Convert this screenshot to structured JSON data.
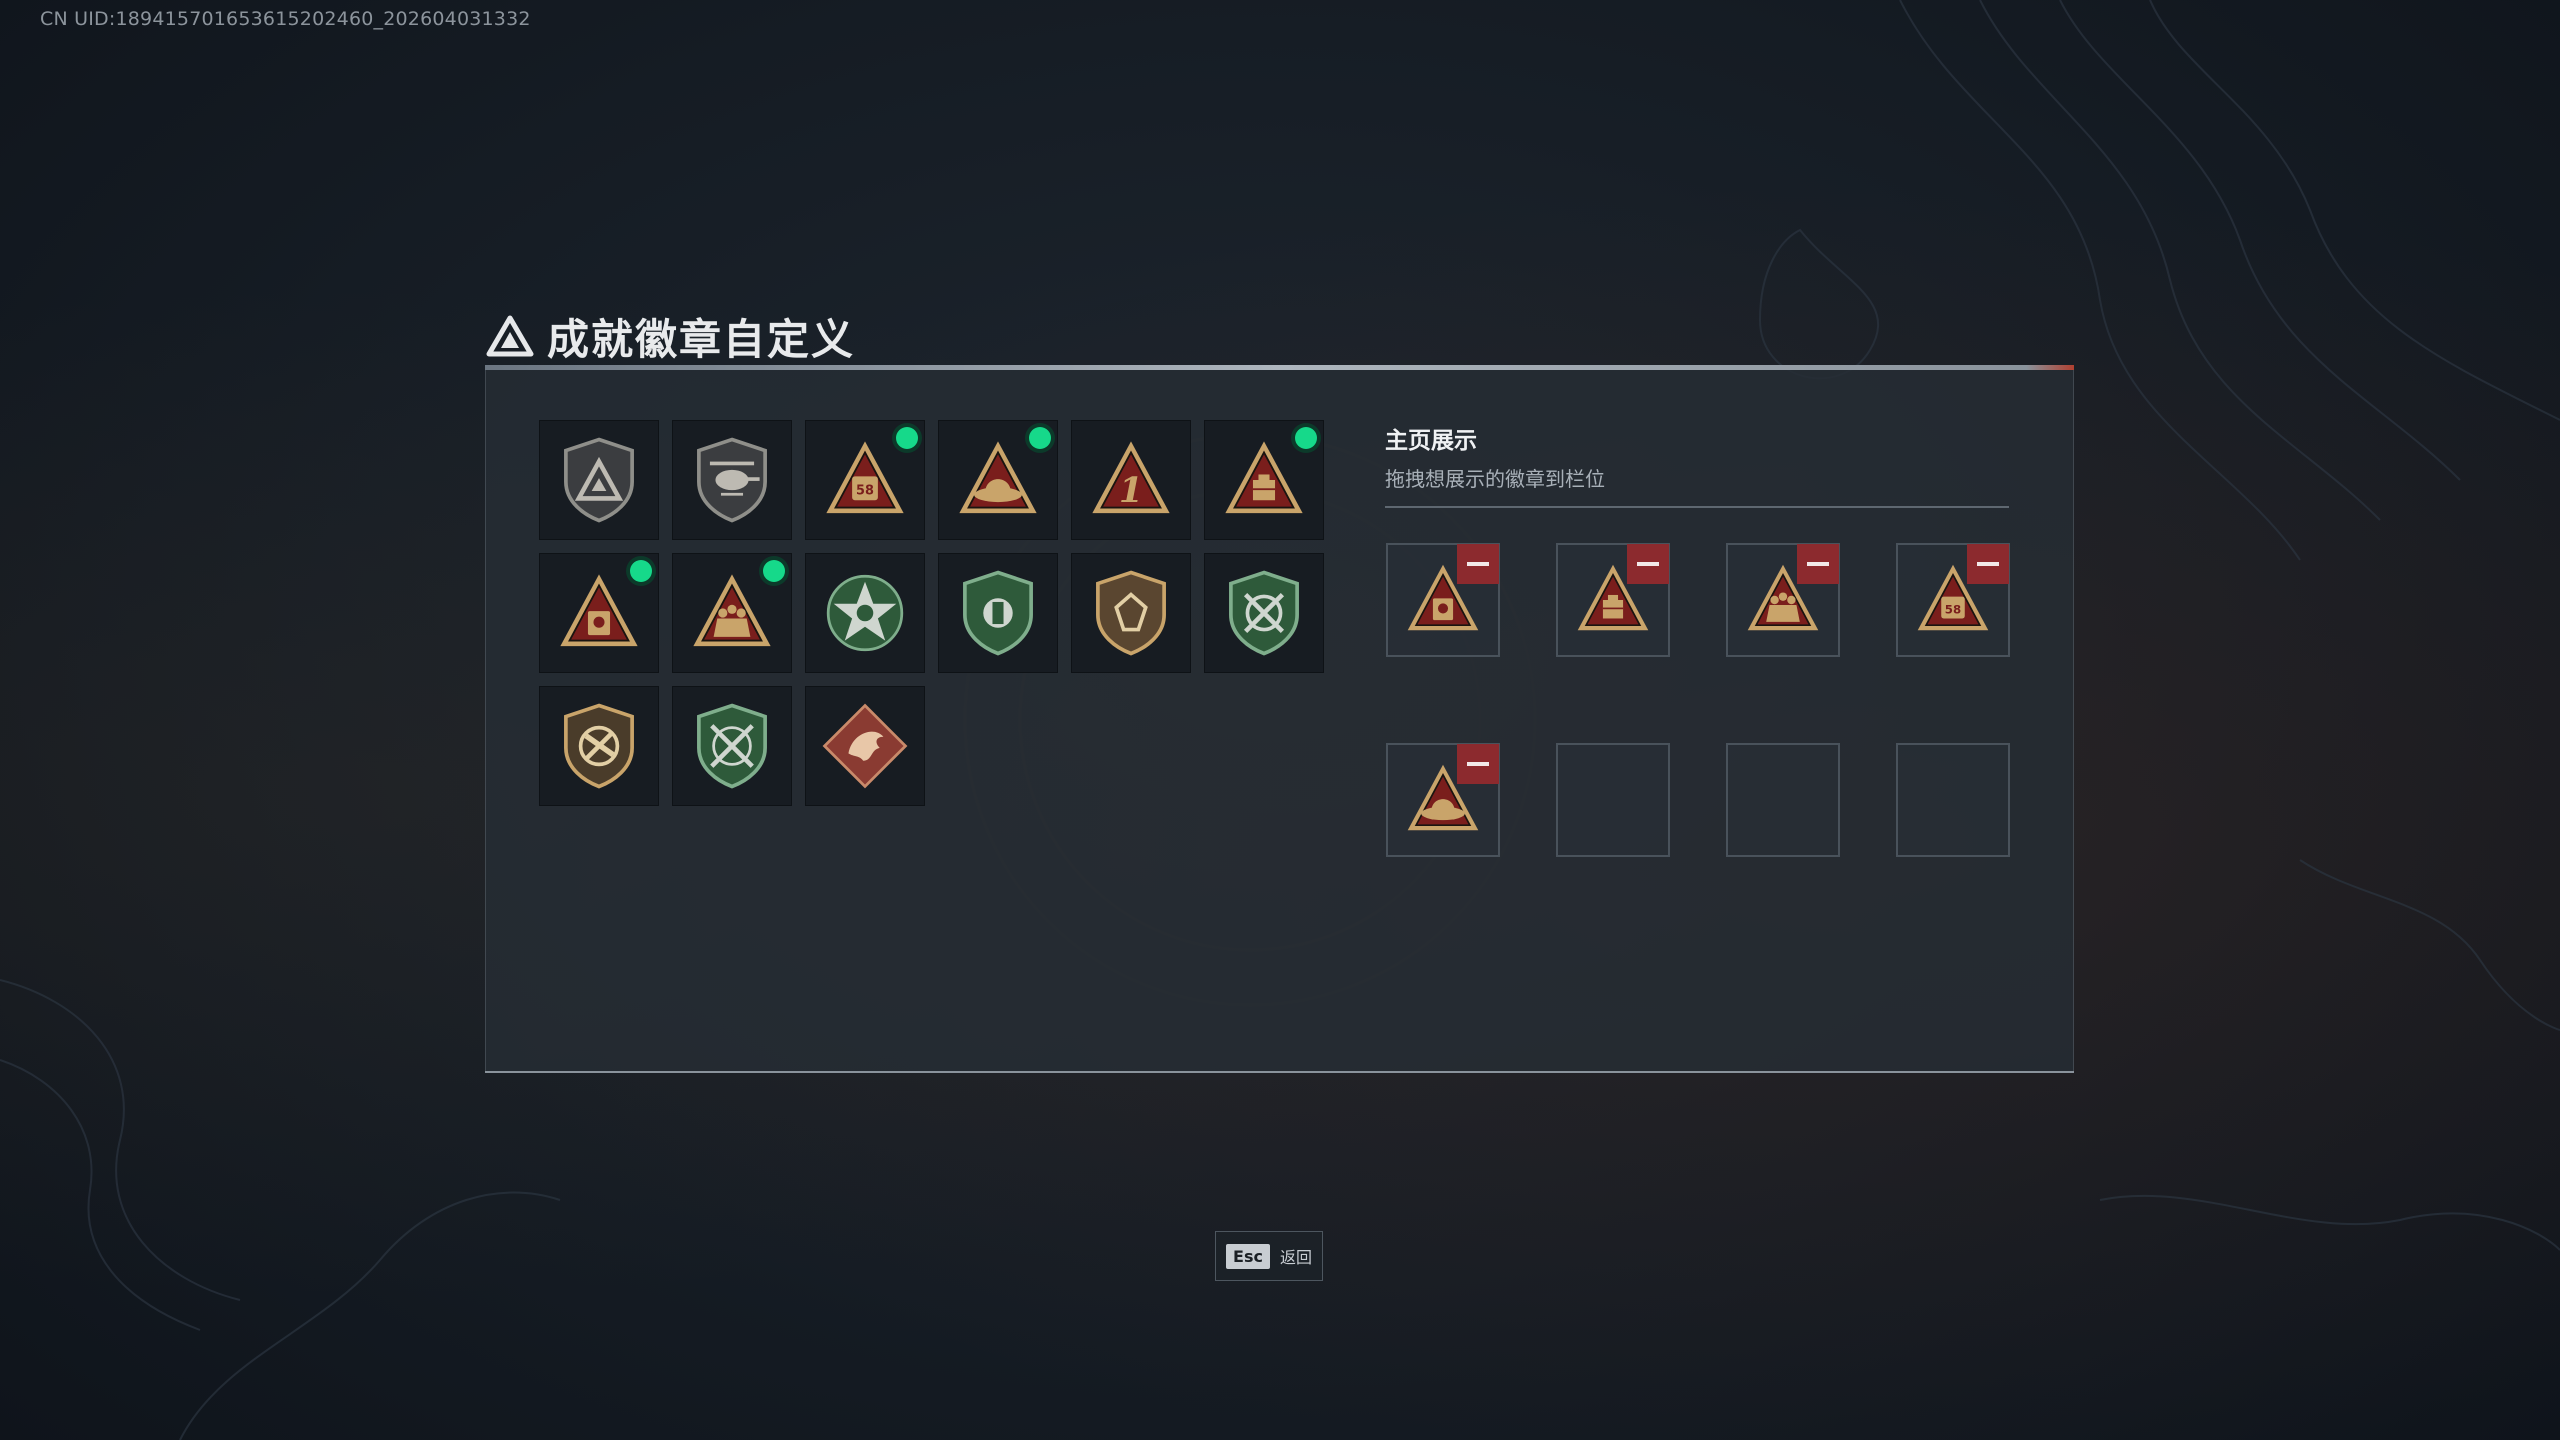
{
  "header": {
    "uid": "CN UID:1894157016536152024​60_202604031332"
  },
  "dialog": {
    "title": "成就徽章自定义",
    "icon": "delta-triangle-icon"
  },
  "badges": [
    {
      "icon": "delta-shield-badge-icon",
      "new": false
    },
    {
      "icon": "helicopter-shield-badge-icon",
      "new": false
    },
    {
      "icon": "triangle-58-badge-icon",
      "new": true
    },
    {
      "icon": "triangle-hat-badge-icon",
      "new": true
    },
    {
      "icon": "triangle-number-1-badge-icon",
      "new": false
    },
    {
      "icon": "triangle-crate-badge-icon",
      "new": true
    },
    {
      "icon": "triangle-skull-crate-badge-icon",
      "new": true
    },
    {
      "icon": "triangle-soldiers-badge-icon",
      "new": true
    },
    {
      "icon": "green-star-badge-icon",
      "new": false
    },
    {
      "icon": "green-shield-emblem-badge-icon",
      "new": false
    },
    {
      "icon": "gem-shield-badge-icon",
      "new": false
    },
    {
      "icon": "green-crossed-rifles-badge-icon",
      "new": false
    },
    {
      "icon": "no-rifle-shield-badge-icon",
      "new": false
    },
    {
      "icon": "green-crossed-arrows-badge-icon",
      "new": false
    },
    {
      "icon": "red-dragon-badge-icon",
      "new": false
    }
  ],
  "showcase": {
    "title": "主页展示",
    "subtitle": "拖拽想展示的徽章到栏位",
    "slots": [
      {
        "icon": "triangle-skull-crate-badge-icon",
        "filled": true
      },
      {
        "icon": "triangle-crate-badge-icon",
        "filled": true
      },
      {
        "icon": "triangle-soldiers-badge-icon",
        "filled": true
      },
      {
        "icon": "triangle-58-badge-icon",
        "filled": true
      },
      {
        "icon": "triangle-hat-badge-icon",
        "filled": true
      },
      {
        "icon": "",
        "filled": false
      },
      {
        "icon": "",
        "filled": false
      },
      {
        "icon": "",
        "filled": false
      }
    ]
  },
  "footer": {
    "esc_key": "Esc",
    "back_label": "返回"
  },
  "colors": {
    "new_dot": "#16d98a",
    "remove_button": "#8c2a2e",
    "badge_gold": "#c9a46a",
    "badge_red": "#7a1e1c",
    "badge_green": "#2e5a3a"
  }
}
